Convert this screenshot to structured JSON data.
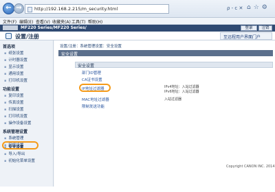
{
  "browser": {
    "url": "http://192.168.2.215/m_security.html",
    "back_glyph": "←",
    "forward_glyph": "→",
    "url_tools": "ρ - c ✕",
    "menu": [
      "文件(F)",
      "编辑(E)",
      "查看(V)",
      "收藏夹(A)",
      "工具(T)",
      "帮助(H)"
    ],
    "right_icons": [
      "home-icon",
      "star-icon",
      "gear-icon"
    ]
  },
  "header": {
    "brand_logo": "imageRUNNER",
    "model": "MF220 Series/MF220 Series/",
    "login_label": "登录",
    "logout_label": "注销",
    "page_title": "设置/注册",
    "portal_link": "至远程用户界面门户"
  },
  "sidebar": {
    "groups": [
      {
        "title": "首选项",
        "items": [
          "纸张设置",
          "计时器设置",
          "显示设置",
          "通用设置",
          "打印机设置"
        ]
      },
      {
        "title": "功能设置",
        "items": [
          "复印设置",
          "传真设置",
          "扫描设置",
          "打印机设置",
          "操作设备设置"
        ]
      },
      {
        "title": "系统管理设置",
        "items": [
          "系统管理",
          "网络设置",
          "安全设置",
          "导入/导出",
          "初始化菜单设置"
        ]
      }
    ],
    "selected": "安全设置"
  },
  "main": {
    "breadcrumb": "设置/注册：系统管理设置：安全设置",
    "section_title": "安全设置",
    "subsection_title": "安全设置",
    "links": [
      "部门ID管理",
      "CA证书设置",
      "IP地址过滤器",
      "MAC地址过滤器",
      "限制发送功能"
    ],
    "ip_filter_notes": [
      "IPv4地址：入站过滤器",
      "IPv6地址：入站过滤器"
    ],
    "mac_filter_note": "入站过滤器",
    "copyright": "Copyright CANON INC. 2014"
  }
}
